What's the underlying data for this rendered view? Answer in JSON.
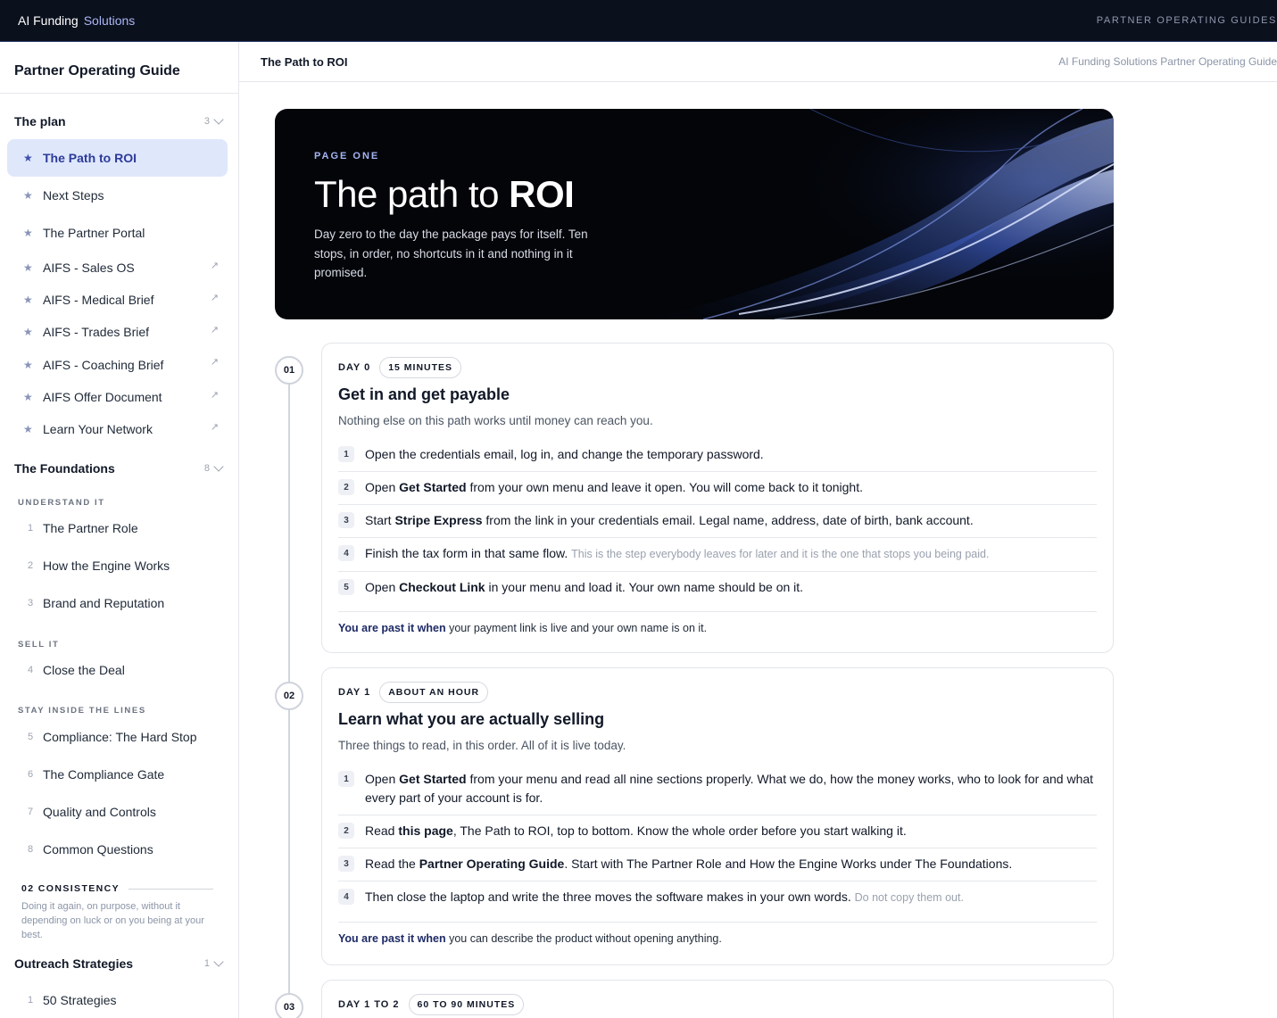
{
  "topbar": {
    "brand_main": "AI Funding",
    "brand_accent": "Solutions",
    "right_label": "PARTNER OPERATING GUIDES"
  },
  "sidebar": {
    "title": "Partner Operating Guide",
    "plan": {
      "label": "The plan",
      "count": "3",
      "items": [
        {
          "label": "The Path to ROI"
        },
        {
          "label": "Next Steps"
        },
        {
          "label": "The Partner Portal"
        },
        {
          "label": "AIFS - Sales OS"
        },
        {
          "label": "AIFS - Medical Brief"
        },
        {
          "label": "AIFS - Trades Brief"
        },
        {
          "label": "AIFS - Coaching Brief"
        },
        {
          "label": "AIFS Offer Document"
        },
        {
          "label": "Learn Your Network"
        }
      ]
    },
    "foundations": {
      "label": "The Foundations",
      "count": "8",
      "groups": [
        {
          "label": "UNDERSTAND IT",
          "items": [
            {
              "num": "1",
              "label": "The Partner Role"
            },
            {
              "num": "2",
              "label": "How the Engine Works"
            },
            {
              "num": "3",
              "label": "Brand and Reputation"
            }
          ]
        },
        {
          "label": "SELL IT",
          "items": [
            {
              "num": "4",
              "label": "Close the Deal"
            }
          ]
        },
        {
          "label": "STAY INSIDE THE LINES",
          "items": [
            {
              "num": "5",
              "label": "Compliance: The Hard Stop"
            },
            {
              "num": "6",
              "label": "The Compliance Gate"
            },
            {
              "num": "7",
              "label": "Quality and Controls"
            },
            {
              "num": "8",
              "label": "Common Questions"
            }
          ]
        }
      ]
    },
    "consistency": {
      "heading": "02 CONSISTENCY",
      "text": "Doing it again, on purpose, without it depending on luck or on you being at your best."
    },
    "outreach": {
      "label": "Outreach Strategies",
      "count": "1",
      "items": [
        {
          "num": "1",
          "label": "50 Strategies"
        }
      ]
    }
  },
  "main": {
    "header_title": "The Path to ROI",
    "header_right": "AI Funding Solutions Partner Operating Guide",
    "hero": {
      "eyebrow": "PAGE ONE",
      "title_light": "The path to ",
      "title_bold": "ROI",
      "lede": "Day zero to the day the package pays for itself. Ten stops, in order, no shortcuts in it and nothing in it promised."
    },
    "stops": [
      {
        "num": "01",
        "day": "DAY 0",
        "duration": "15 MINUTES",
        "title": "Get in and get payable",
        "intro": "Nothing else on this path works until money can reach you.",
        "steps": [
          {
            "n": "1",
            "parts": [
              {
                "t": "Open the credentials email, log in, and change the temporary password."
              }
            ]
          },
          {
            "n": "2",
            "parts": [
              {
                "t": "Open "
              },
              {
                "t": "Get Started",
                "b": true
              },
              {
                "t": " from your own menu and leave it open. You will come back to it tonight."
              }
            ]
          },
          {
            "n": "3",
            "parts": [
              {
                "t": "Start "
              },
              {
                "t": "Stripe Express",
                "b": true
              },
              {
                "t": " from the link in your credentials email. Legal name, address, date of birth, bank account."
              }
            ]
          },
          {
            "n": "4",
            "parts": [
              {
                "t": "Finish the tax form in that same flow. "
              },
              {
                "t": "This is the step everybody leaves for later and it is the one that stops you being paid.",
                "m": true
              }
            ]
          },
          {
            "n": "5",
            "parts": [
              {
                "t": "Open "
              },
              {
                "t": "Checkout Link",
                "b": true
              },
              {
                "t": " in your menu and load it. Your own name should be on it."
              }
            ]
          }
        ],
        "past_label": "You are past it when",
        "past_text": " your payment link is live and your own name is on it."
      },
      {
        "num": "02",
        "day": "DAY 1",
        "duration": "ABOUT AN HOUR",
        "title": "Learn what you are actually selling",
        "intro": "Three things to read, in this order. All of it is live today.",
        "steps": [
          {
            "n": "1",
            "parts": [
              {
                "t": "Open "
              },
              {
                "t": "Get Started",
                "b": true
              },
              {
                "t": " from your menu and read all nine sections properly. What we do, how the money works, who to look for and what every part of your account is for."
              }
            ]
          },
          {
            "n": "2",
            "parts": [
              {
                "t": "Read "
              },
              {
                "t": "this page",
                "b": true
              },
              {
                "t": ", The Path to ROI, top to bottom. Know the whole order before you start walking it."
              }
            ]
          },
          {
            "n": "3",
            "parts": [
              {
                "t": "Read the "
              },
              {
                "t": "Partner Operating Guide",
                "b": true
              },
              {
                "t": ". Start with The Partner Role and How the Engine Works under The Foundations."
              }
            ]
          },
          {
            "n": "4",
            "parts": [
              {
                "t": "Then close the laptop and write the three moves the software makes in your own words. "
              },
              {
                "t": "Do not copy them out.",
                "m": true
              }
            ]
          }
        ],
        "past_label": "You are past it when",
        "past_text": " you can describe the product without opening anything."
      },
      {
        "num": "03",
        "day": "DAY 1 TO 2",
        "duration": "60 TO 90 MINUTES"
      }
    ]
  }
}
